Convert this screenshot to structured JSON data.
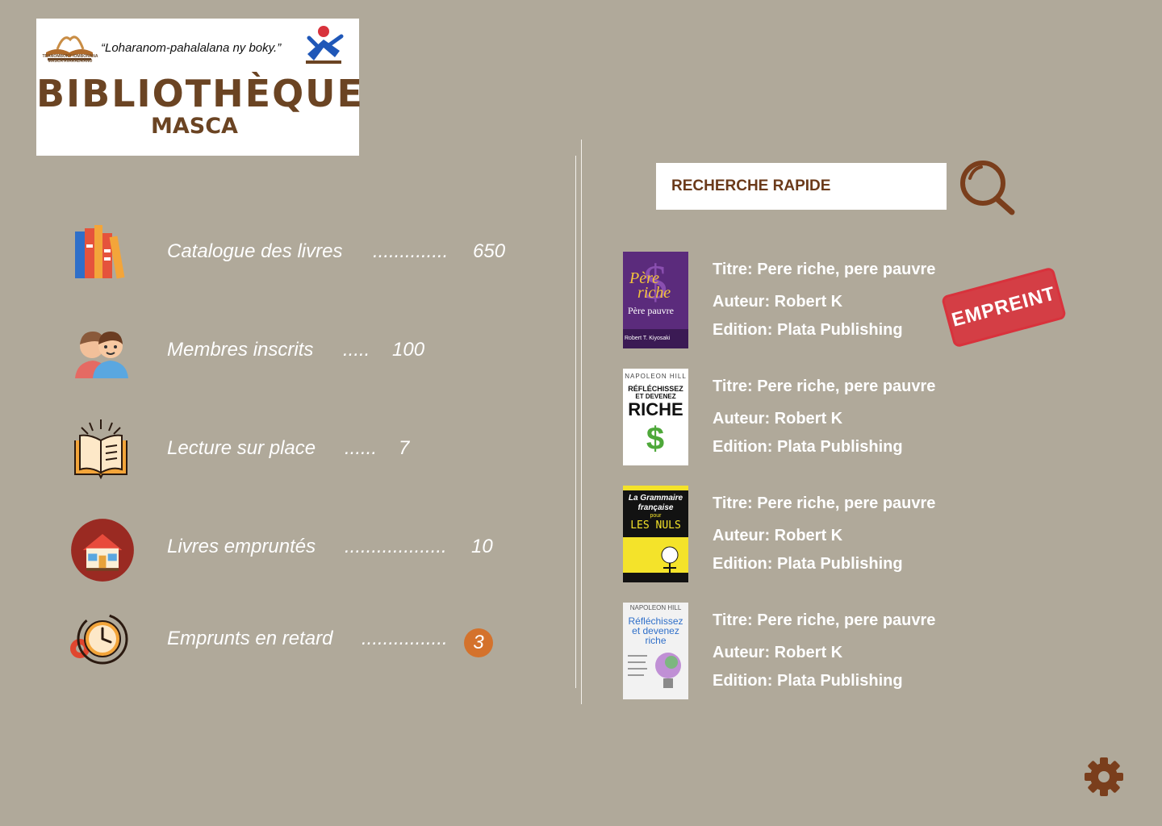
{
  "header": {
    "logo_line1": "TRANOMBOKY IOMBONANA",
    "logo_line2": "MASCA AVARADRANO",
    "slogan": "“Loharanom-pahalalana ny boky.”",
    "title": "BIBLIOTHÈQUE",
    "subtitle": "MASCA"
  },
  "stats": [
    {
      "label": "Catalogue des livres",
      "dots": "..............",
      "value": "650",
      "icon": "books-icon"
    },
    {
      "label": "Membres inscrits",
      "dots": ".....",
      "value": "100",
      "icon": "members-icon"
    },
    {
      "label": "Lecture sur place",
      "dots": "......",
      "value": "7",
      "icon": "open-book-icon"
    },
    {
      "label": "Livres empruntés",
      "dots": "...................",
      "value": "10",
      "icon": "house-icon"
    },
    {
      "label": "Emprunts en retard",
      "dots": "................",
      "value": "3",
      "icon": "clock-gear-icon"
    }
  ],
  "search": {
    "placeholder": "RECHERCHE RAPIDE",
    "icon": "magnifier-icon"
  },
  "books": [
    {
      "title": "Titre: Pere riche, pere pauvre",
      "author": "Auteur: Robert K",
      "edition": "Edition: Plata Publishing",
      "stamp": "EMPREINT",
      "cover": {
        "line1": "Père",
        "line2": "riche",
        "line3": "Père pauvre",
        "footer": "Robert T. Kiyosaki"
      }
    },
    {
      "title": "Titre: Pere riche, pere pauvre",
      "author": "Auteur: Robert K",
      "edition": "Edition: Plata Publishing",
      "cover": {
        "line1": "NAPOLEON HILL",
        "line2": "RÉFLÉCHISSEZ",
        "line3": "ET DEVENEZ",
        "line4": "RICHE"
      }
    },
    {
      "title": "Titre: Pere riche, pere pauvre",
      "author": "Auteur: Robert K",
      "edition": "Edition: Plata Publishing",
      "cover": {
        "line1": "La Grammaire",
        "line2": "française",
        "line3": "pour",
        "line4": "LES NULS"
      }
    },
    {
      "title": "Titre: Pere riche, pere pauvre",
      "author": "Auteur: Robert K",
      "edition": "Edition: Plata Publishing",
      "cover": {
        "line1": "NAPOLEON HILL",
        "line2": "Réfléchissez",
        "line3": "et devenez",
        "line4": "riche"
      }
    }
  ],
  "colors": {
    "background": "#b0a99a",
    "brand_brown": "#6b4423",
    "badge_orange": "#d4722c",
    "stamp_red": "#d8323c"
  },
  "settings": {
    "icon": "gear-icon"
  }
}
